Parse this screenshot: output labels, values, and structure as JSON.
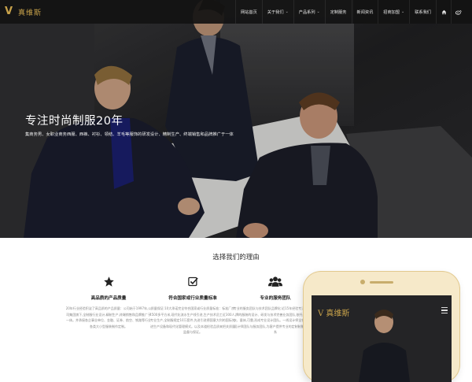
{
  "logo": {
    "text": "真维斯"
  },
  "nav": {
    "items": [
      {
        "label": "网站首页",
        "has_dropdown": false
      },
      {
        "label": "关于我们",
        "has_dropdown": true
      },
      {
        "label": "产品系列",
        "has_dropdown": true
      },
      {
        "label": "定制服务",
        "has_dropdown": false
      },
      {
        "label": "新闻资讯",
        "has_dropdown": false
      },
      {
        "label": "招商加盟",
        "has_dropdown": true
      },
      {
        "label": "联系我们",
        "has_dropdown": false
      }
    ],
    "icons": [
      "home-icon",
      "weibo-icon"
    ]
  },
  "hero": {
    "headline": "专注时尚制服20年",
    "subline": "集商务男、女职业商务西服、西裤、衬衫、领结、羊毛等服饰的研发设计、精制生产、终端销售和品牌推广于一体"
  },
  "why": {
    "title": "选择我们的理由",
    "features": [
      {
        "icon": "star-icon",
        "title": "高品质的产品质量",
        "desc": "20年行业经验积淀了高品质的产品质量：公司始于1997年,公司集团旗下,全制服行业设计,精制生产,终端销售和品牌推广于一体。并承接各企事业单位、金融、证券、航空、铁路等行业各类大小型服装制作定制。"
      },
      {
        "icon": "check-icon",
        "title": "符合国家或行业质量标准",
        "desc": "质量保证:10大承诺完全符合国家或行业质量标准：标准厂房4500多平方米,现代化流水生产线引进,生产技术员工近300人,专业生产,全制服规定10万套件,先进引进德国意大利的国际先进生产设备和现代化管理模式。以及本道检验品质来把关质量监督与保证。"
      },
      {
        "icon": "team-icon",
        "title": "专业的服务团队",
        "desc": "专业的服务团队与技术团队品牌化:近15年经验专注于一线品牌的服装的设计、研发与技术完善业务团队,依托于量体裁衣、量体,可靠,形成专业设计团队。一线设计师全程服务项目设计师团队与服务团队,为客户提供专业的定制制服的服务体系"
      }
    ]
  },
  "phone": {
    "logo": "真维斯"
  },
  "colors": {
    "gold": "#c8a24a",
    "nav_bg": "#121212"
  }
}
